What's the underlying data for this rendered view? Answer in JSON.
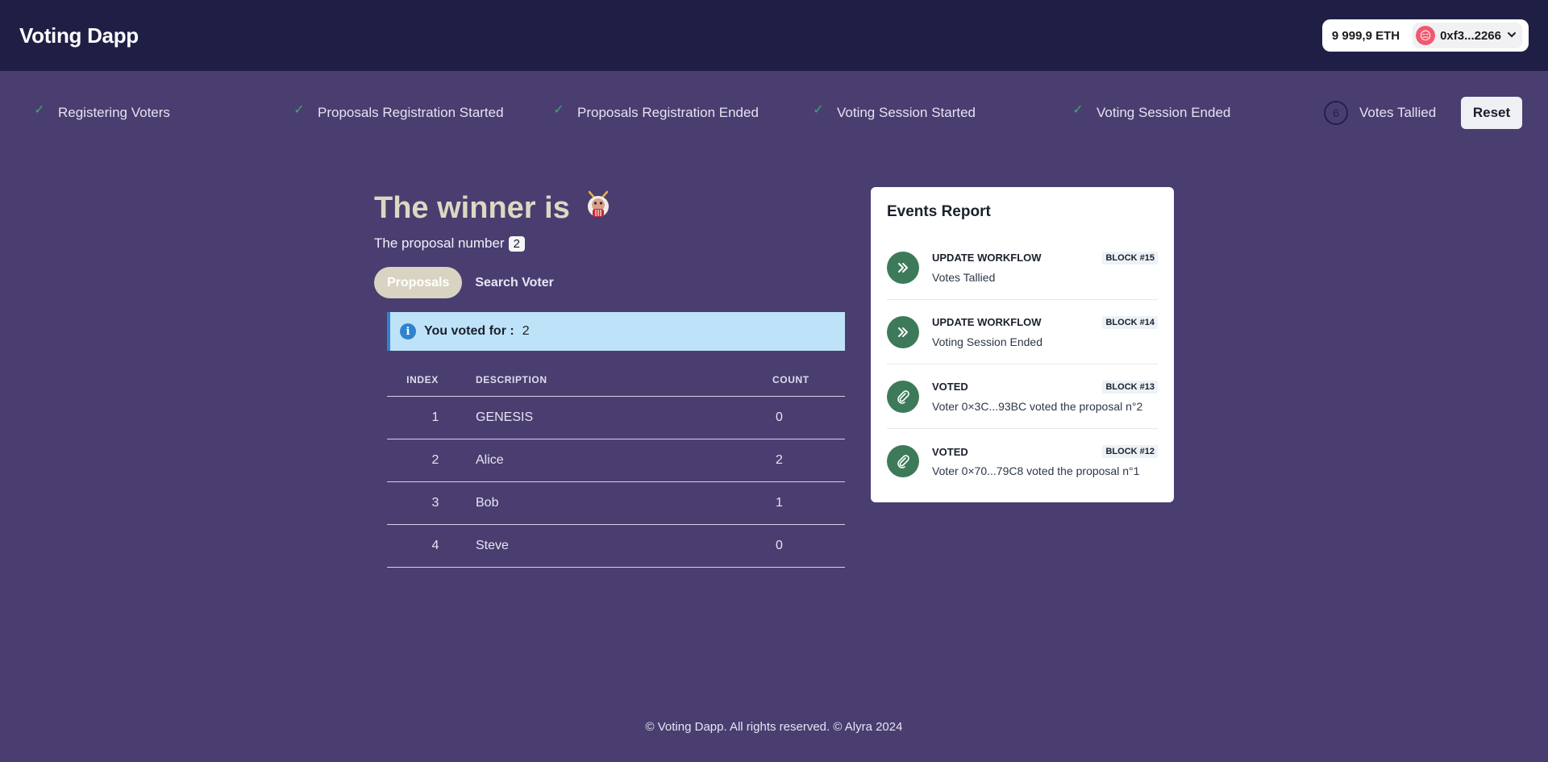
{
  "header": {
    "brand": "Voting Dapp",
    "wallet": {
      "balance": "9 999,9 ETH",
      "address": "0xf3...2266"
    }
  },
  "stepper": {
    "steps": [
      {
        "label": "Registering Voters",
        "state": "done"
      },
      {
        "label": "Proposals Registration Started",
        "state": "done"
      },
      {
        "label": "Proposals Registration Ended",
        "state": "done"
      },
      {
        "label": "Voting Session Started",
        "state": "done"
      },
      {
        "label": "Voting Session Ended",
        "state": "done"
      },
      {
        "label": "Votes Tallied",
        "state": "current",
        "number": "6"
      }
    ],
    "reset_label": "Reset"
  },
  "winner": {
    "title": "The winner is",
    "proposal_label": "The proposal number",
    "proposal_number": "2"
  },
  "tabs": [
    {
      "label": "Proposals",
      "active": true
    },
    {
      "label": "Search Voter",
      "active": false
    }
  ],
  "alert": {
    "label": "You voted for :",
    "value": "2"
  },
  "table": {
    "headers": {
      "index": "INDEX",
      "description": "DESCRIPTION",
      "count": "COUNT"
    },
    "rows": [
      {
        "index": "1",
        "description": "GENESIS",
        "count": "0"
      },
      {
        "index": "2",
        "description": "Alice",
        "count": "2"
      },
      {
        "index": "3",
        "description": "Bob",
        "count": "1"
      },
      {
        "index": "4",
        "description": "Steve",
        "count": "0"
      }
    ]
  },
  "events": {
    "title": "Events Report",
    "items": [
      {
        "type": "UPDATE WORKFLOW",
        "block": "BLOCK #15",
        "description": "Votes Tallied",
        "icon": "chevrons-right-icon"
      },
      {
        "type": "UPDATE WORKFLOW",
        "block": "BLOCK #14",
        "description": "Voting Session Ended",
        "icon": "chevrons-right-icon"
      },
      {
        "type": "VOTED",
        "block": "BLOCK #13",
        "description": "Voter 0×3C...93BC voted the proposal n°2",
        "icon": "paperclip-icon"
      },
      {
        "type": "VOTED",
        "block": "BLOCK #12",
        "description": "Voter 0×70...79C8 voted the proposal n°1",
        "icon": "paperclip-icon"
      }
    ]
  },
  "footer": {
    "text": "© Voting Dapp. All rights reserved. © Alyra 2024"
  },
  "colors": {
    "background": "#4a3e70",
    "header": "#1f1f46",
    "check": "#3fa770",
    "event_icon": "#3d7a5a",
    "alert_bg": "#bee3f8",
    "alert_accent": "#3182ce"
  }
}
